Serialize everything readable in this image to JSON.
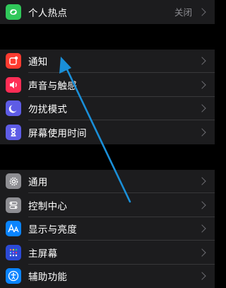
{
  "groups": [
    {
      "items": [
        {
          "label": "个人热点",
          "value": "关闭",
          "icon": "hotspot-icon",
          "color": "#30c85a"
        }
      ]
    },
    {
      "items": [
        {
          "label": "通知",
          "icon": "notifications-icon",
          "color": "#ff3b30"
        },
        {
          "label": "声音与触感",
          "icon": "speaker-icon",
          "color": "#ff2d55"
        },
        {
          "label": "勿扰模式",
          "icon": "moon-icon",
          "color": "#5e5ce6"
        },
        {
          "label": "屏幕使用时间",
          "icon": "hourglass-icon",
          "color": "#5e5ce6"
        }
      ]
    },
    {
      "items": [
        {
          "label": "通用",
          "icon": "gear-icon",
          "color": "#8e8e93"
        },
        {
          "label": "控制中心",
          "icon": "toggles-icon",
          "color": "#8e8e93"
        },
        {
          "label": "显示与亮度",
          "icon": "text-size-icon",
          "color": "#0a84ff"
        },
        {
          "label": "主屏幕",
          "icon": "home-grid-icon",
          "color": "#2c4ad6"
        },
        {
          "label": "辅助功能",
          "icon": "accessibility-icon",
          "color": "#0a84ff"
        }
      ]
    }
  ],
  "annotation": {
    "arrow_color": "#1a8fd8",
    "icon": "arrow-icon"
  }
}
